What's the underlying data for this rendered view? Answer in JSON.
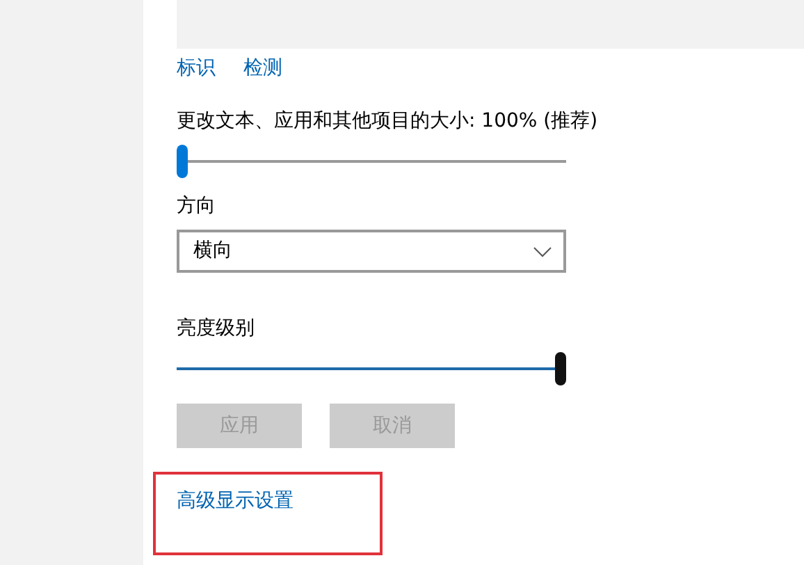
{
  "links": [
    {
      "label": "标识"
    },
    {
      "label": "检测"
    }
  ],
  "scale": {
    "label": "更改文本、应用和其他项目的大小: 100% (推荐)",
    "kind": "accent",
    "level": 0
  },
  "orientation": {
    "label": "方向",
    "value": "横向"
  },
  "brightness": {
    "label": "亮度级别",
    "kind": "dark",
    "level": 1
  },
  "buttons": [
    {
      "label": "应用",
      "disabled": true
    },
    {
      "label": "取消",
      "disabled": true
    }
  ],
  "advanced_link": {
    "label": "高级显示设置",
    "highlighted": true
  }
}
